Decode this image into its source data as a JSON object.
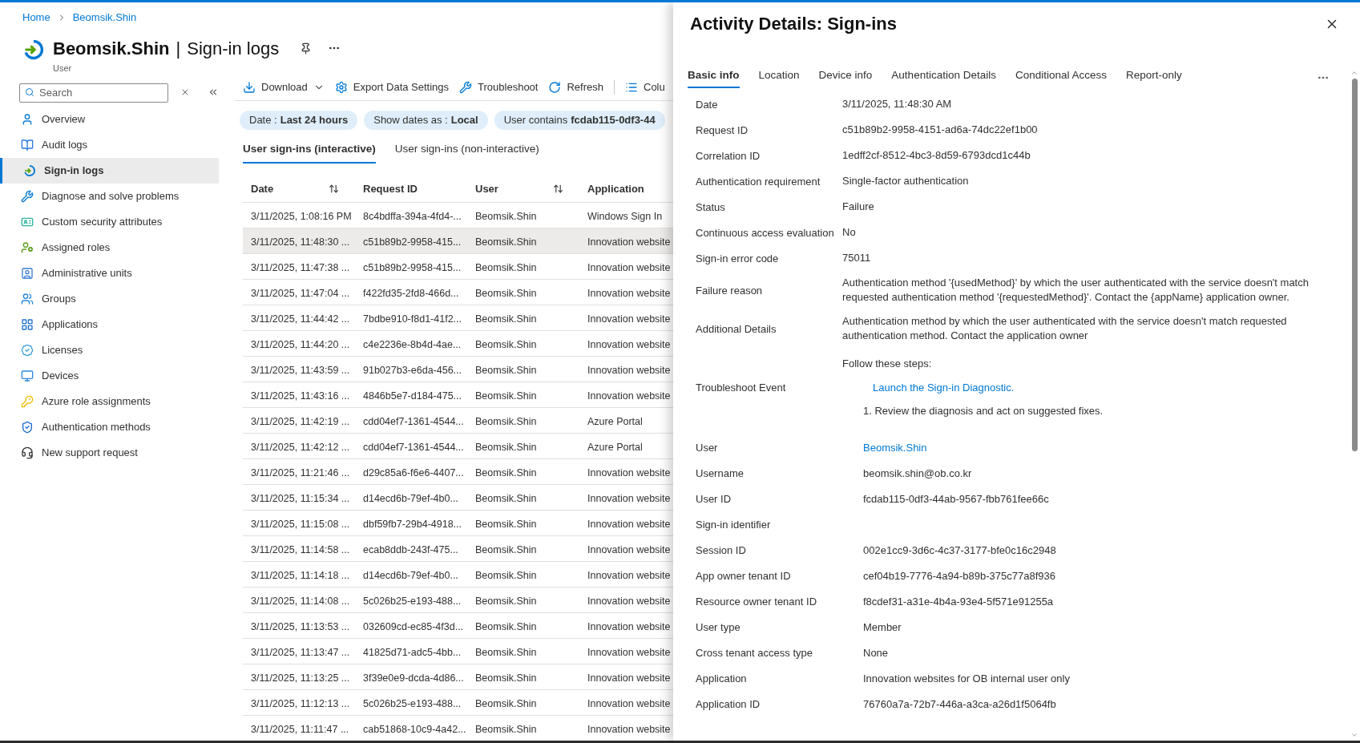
{
  "breadcrumbs": [
    {
      "label": "Home"
    },
    {
      "label": "Beomsik.Shin"
    }
  ],
  "header": {
    "name": "Beomsik.Shin",
    "separator": "|",
    "page": "Sign-in logs",
    "subtitle": "User"
  },
  "sidebar": {
    "search": {
      "placeholder": "Search"
    },
    "items": [
      {
        "label": "Overview",
        "selected": false
      },
      {
        "label": "Audit logs",
        "selected": false
      },
      {
        "label": "Sign-in logs",
        "selected": true
      },
      {
        "label": "Diagnose and solve problems",
        "selected": false
      },
      {
        "label": "Custom security attributes",
        "selected": false
      },
      {
        "label": "Assigned roles",
        "selected": false
      },
      {
        "label": "Administrative units",
        "selected": false
      },
      {
        "label": "Groups",
        "selected": false
      },
      {
        "label": "Applications",
        "selected": false
      },
      {
        "label": "Licenses",
        "selected": false
      },
      {
        "label": "Devices",
        "selected": false
      },
      {
        "label": "Azure role assignments",
        "selected": false
      },
      {
        "label": "Authentication methods",
        "selected": false
      },
      {
        "label": "New support request",
        "selected": false
      }
    ]
  },
  "toolbar": [
    {
      "label": "Download"
    },
    {
      "label": "Export Data Settings"
    },
    {
      "label": "Troubleshoot"
    },
    {
      "label": "Refresh"
    },
    {
      "label": "Colu"
    }
  ],
  "filters": [
    {
      "label": "Date :",
      "value": "Last 24 hours"
    },
    {
      "label": "Show dates as :",
      "value": "Local"
    },
    {
      "label": "User contains",
      "value": "fcdab115-0df3-44"
    }
  ],
  "tabs": [
    {
      "label": "User sign-ins (interactive)",
      "selected": true
    },
    {
      "label": "User sign-ins (non-interactive)",
      "selected": false
    }
  ],
  "table": {
    "columns": [
      {
        "label": "Date",
        "sortable": true
      },
      {
        "label": "Request ID",
        "sortable": false
      },
      {
        "label": "User",
        "sortable": true
      },
      {
        "label": "Application",
        "sortable": false
      }
    ],
    "rows": [
      {
        "cells": [
          "3/11/2025, 1:08:16 PM",
          "8c4bdffa-394a-4fd4-...",
          "Beomsik.Shin",
          "Windows Sign In"
        ],
        "selected": false
      },
      {
        "cells": [
          "3/11/2025, 11:48:30 ...",
          "c51b89b2-9958-415...",
          "Beomsik.Shin",
          "Innovation website"
        ],
        "selected": true
      },
      {
        "cells": [
          "3/11/2025, 11:47:38 ...",
          "c51b89b2-9958-415...",
          "Beomsik.Shin",
          "Innovation website"
        ],
        "selected": false
      },
      {
        "cells": [
          "3/11/2025, 11:47:04 ...",
          "f422fd35-2fd8-466d...",
          "Beomsik.Shin",
          "Innovation website"
        ],
        "selected": false
      },
      {
        "cells": [
          "3/11/2025, 11:44:42 ...",
          "7bdbe910-f8d1-41f2...",
          "Beomsik.Shin",
          "Innovation website"
        ],
        "selected": false
      },
      {
        "cells": [
          "3/11/2025, 11:44:20 ...",
          "c4e2236e-8b4d-4ae...",
          "Beomsik.Shin",
          "Innovation website"
        ],
        "selected": false
      },
      {
        "cells": [
          "3/11/2025, 11:43:59 ...",
          "91b027b3-e6da-456...",
          "Beomsik.Shin",
          "Innovation website"
        ],
        "selected": false
      },
      {
        "cells": [
          "3/11/2025, 11:43:16 ...",
          "4846b5e7-d184-475...",
          "Beomsik.Shin",
          "Innovation website"
        ],
        "selected": false
      },
      {
        "cells": [
          "3/11/2025, 11:42:19 ...",
          "cdd04ef7-1361-4544...",
          "Beomsik.Shin",
          "Azure Portal"
        ],
        "selected": false
      },
      {
        "cells": [
          "3/11/2025, 11:42:12 ...",
          "cdd04ef7-1361-4544...",
          "Beomsik.Shin",
          "Azure Portal"
        ],
        "selected": false
      },
      {
        "cells": [
          "3/11/2025, 11:21:46 ...",
          "d29c85a6-f6e6-4407...",
          "Beomsik.Shin",
          "Innovation website"
        ],
        "selected": false
      },
      {
        "cells": [
          "3/11/2025, 11:15:34 ...",
          "d14ecd6b-79ef-4b0...",
          "Beomsik.Shin",
          "Innovation website"
        ],
        "selected": false
      },
      {
        "cells": [
          "3/11/2025, 11:15:08 ...",
          "dbf59fb7-29b4-4918...",
          "Beomsik.Shin",
          "Innovation website"
        ],
        "selected": false
      },
      {
        "cells": [
          "3/11/2025, 11:14:58 ...",
          "ecab8ddb-243f-475...",
          "Beomsik.Shin",
          "Innovation website"
        ],
        "selected": false
      },
      {
        "cells": [
          "3/11/2025, 11:14:18 ...",
          "d14ecd6b-79ef-4b0...",
          "Beomsik.Shin",
          "Innovation website"
        ],
        "selected": false
      },
      {
        "cells": [
          "3/11/2025, 11:14:08 ...",
          "5c026b25-e193-488...",
          "Beomsik.Shin",
          "Innovation website"
        ],
        "selected": false
      },
      {
        "cells": [
          "3/11/2025, 11:13:53 ...",
          "032609cd-ec85-4f3d...",
          "Beomsik.Shin",
          "Innovation website"
        ],
        "selected": false
      },
      {
        "cells": [
          "3/11/2025, 11:13:47 ...",
          "41825d71-adc5-4bb...",
          "Beomsik.Shin",
          "Innovation website"
        ],
        "selected": false
      },
      {
        "cells": [
          "3/11/2025, 11:13:25 ...",
          "3f39e0e9-dcda-4d86...",
          "Beomsik.Shin",
          "Innovation website"
        ],
        "selected": false
      },
      {
        "cells": [
          "3/11/2025, 11:12:13 ...",
          "5c026b25-e193-488...",
          "Beomsik.Shin",
          "Innovation website"
        ],
        "selected": false
      },
      {
        "cells": [
          "3/11/2025, 11:11:47 ...",
          "cab51868-10c9-4a42...",
          "Beomsik.Shin",
          "Innovation website"
        ],
        "selected": false
      }
    ]
  },
  "details": {
    "title": "Activity Details: Sign-ins",
    "tabs": [
      {
        "label": "Basic info",
        "selected": true
      },
      {
        "label": "Location",
        "selected": false
      },
      {
        "label": "Device info",
        "selected": false
      },
      {
        "label": "Authentication Details",
        "selected": false
      },
      {
        "label": "Conditional Access",
        "selected": false
      },
      {
        "label": "Report-only",
        "selected": false
      }
    ],
    "sections": [
      {
        "rows": [
          {
            "kind": "text",
            "label": "Date",
            "value": "3/11/2025, 11:48:30 AM"
          },
          {
            "kind": "text",
            "label": "Request ID",
            "value": "c51b89b2-9958-4151-ad6a-74dc22ef1b00"
          },
          {
            "kind": "text",
            "label": "Correlation ID",
            "value": "1edff2cf-8512-4bc3-8d59-6793dcd1c44b"
          },
          {
            "kind": "text",
            "label": "Authentication requirement",
            "value": "Single-factor authentication"
          },
          {
            "kind": "text",
            "label": "Status",
            "value": "Failure"
          },
          {
            "kind": "text",
            "label": "Continuous access evaluation",
            "value": "No"
          },
          {
            "kind": "text",
            "label": "Sign-in error code",
            "value": "75011"
          },
          {
            "kind": "text",
            "label": "Failure reason",
            "value": "Authentication method '{usedMethod}' by which the user authenticated with the service doesn't match requested authentication method '{requestedMethod}'. Contact the {appName} application owner."
          },
          {
            "kind": "text",
            "label": "Additional Details",
            "value": "Authentication method by which the user authenticated with the service doesn't match requested authentication method. Contact the application owner"
          },
          {
            "kind": "steps",
            "label": "Troubleshoot Event",
            "intro": "Follow these steps:",
            "link": "Launch the Sign-in Diagnostic.",
            "steps": [
              "1. Review the diagnosis and act on suggested fixes."
            ]
          }
        ]
      },
      {
        "rows": [
          {
            "kind": "link",
            "label": "User",
            "value": "Beomsik.Shin"
          },
          {
            "kind": "text",
            "label": "Username",
            "value": "beomsik.shin@ob.co.kr"
          },
          {
            "kind": "text",
            "label": "User ID",
            "value": "fcdab115-0df3-44ab-9567-fbb761fee66c"
          },
          {
            "kind": "text",
            "label": "Sign-in identifier"
          },
          {
            "kind": "text",
            "label": "Session ID",
            "value": "002e1cc9-3d6c-4c37-3177-bfe0c16c2948"
          },
          {
            "kind": "text",
            "label": "App owner tenant ID",
            "value": "cef04b19-7776-4a94-b89b-375c77a8f936"
          },
          {
            "kind": "text",
            "label": "Resource owner tenant ID",
            "value": "f8cdef31-a31e-4b4a-93e4-5f571e91255a"
          },
          {
            "kind": "text",
            "label": "User type",
            "value": "Member"
          },
          {
            "kind": "text",
            "label": "Cross tenant access type",
            "value": "None"
          },
          {
            "kind": "text",
            "label": "Application",
            "value": "Innovation websites for OB internal user only"
          },
          {
            "kind": "text",
            "label": "Application ID",
            "value": "76760a7a-72b7-446a-a3ca-a26d1f5064fb"
          }
        ]
      }
    ]
  }
}
